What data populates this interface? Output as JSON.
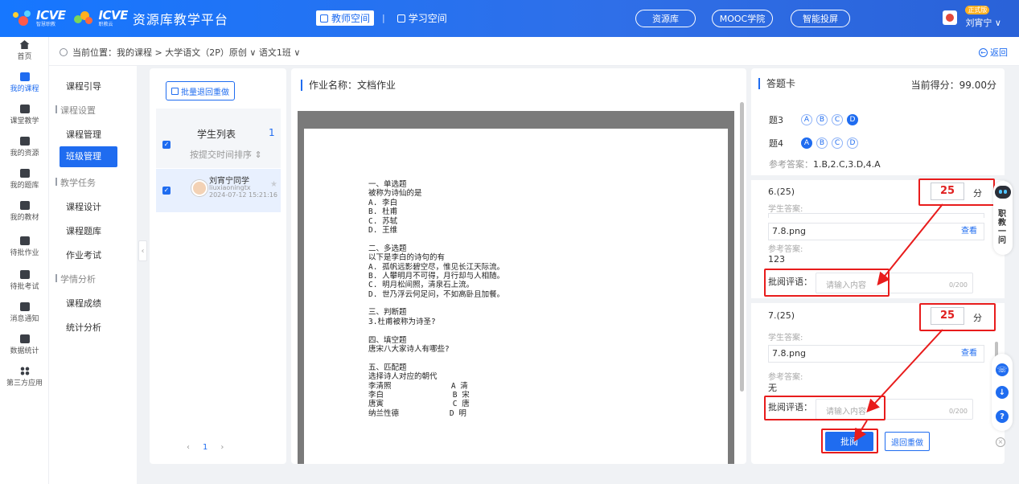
{
  "header": {
    "logo1_text": "ICVE",
    "logo1_sub": "智慧职教",
    "logo2_text": "ICVE",
    "logo2_sub": "职教云",
    "platform_title": "资源库教学平台",
    "tab_teacher": "教师空间",
    "tab_student": "学习空间",
    "nav_resources": "资源库",
    "nav_mooc": "MOOC学院",
    "nav_screen": "智能投屏",
    "user_badge": "正式版",
    "user_name": "刘宵宁 ∨"
  },
  "rail": [
    {
      "label": "首页",
      "icon": "home-icon"
    },
    {
      "label": "我的课程",
      "icon": "book-icon"
    },
    {
      "label": "课堂教学",
      "icon": "play-icon"
    },
    {
      "label": "我的资源",
      "icon": "folder-icon"
    },
    {
      "label": "我的题库",
      "icon": "question-bank-icon"
    },
    {
      "label": "我的教材",
      "icon": "textbook-icon"
    },
    {
      "label": "待批作业",
      "icon": "homework-icon"
    },
    {
      "label": "待批考试",
      "icon": "exam-icon"
    },
    {
      "label": "消息通知",
      "icon": "message-icon"
    },
    {
      "label": "数据统计",
      "icon": "stats-icon"
    },
    {
      "label": "第三方应用",
      "icon": "apps-icon"
    }
  ],
  "breadcrumb": {
    "text": "当前位置：我的课程 > 大学语文（2P）原创 ∨  语文1班 ∨",
    "back": "返回"
  },
  "subnav": {
    "guide": "课程引导",
    "group_settings": "课程设置",
    "course_manage": "课程管理",
    "class_manage": "班级管理",
    "group_tasks": "教学任务",
    "course_design": "课程设计",
    "course_bank": "课程题库",
    "homework_exam": "作业考试",
    "group_analysis": "学情分析",
    "course_grades": "课程成绩",
    "stats": "统计分析"
  },
  "students": {
    "batch_button": "批量退回重做",
    "title": "学生列表",
    "count": "1",
    "sort": "按提交时间排序 ⇕",
    "rows": [
      {
        "name": "刘宵宁同学",
        "id": "liuxiaoningtx",
        "time": "2024-07-12 15:21:16"
      }
    ],
    "page": "1"
  },
  "doc": {
    "title_label": "作业名称：",
    "title": "文档作业",
    "lines": [
      "一、单选题",
      "被称为诗仙的是",
      "A. 李白",
      "B. 杜甫",
      "C. 苏轼",
      "D. 王维",
      "",
      "二、多选题",
      "以下是李白的诗句的有",
      "A. 孤帆远影碧空尽，惟见长江天际流。",
      "B. 人攀明月不可得，月行却与人相随。",
      "C. 明月松间照，清泉石上流。",
      "D. 世乃浮云何足问，不如高卧且加餐。",
      "",
      "三、判断题",
      "3.杜甫被称为诗圣?",
      "",
      "四、填空题",
      "唐宋八大家诗人有哪些?",
      "",
      "五、匹配题",
      "选择诗人对应的朝代",
      "李清照             A 清",
      "李白               B 宋",
      "唐寅               C 唐",
      "纳兰性德           D 明"
    ]
  },
  "card": {
    "title": "答题卡",
    "score_label": "当前得分：",
    "score": "99.00分",
    "q3": {
      "label": "题3",
      "options": [
        "A",
        "B",
        "C",
        "D"
      ],
      "selected": "D"
    },
    "q4": {
      "label": "题4",
      "options": [
        "A",
        "B",
        "C",
        "D"
      ],
      "selected": "A"
    },
    "ref_label": "参考答案：",
    "ref_value": "1.B,2.C,3.D,4.A",
    "q6": {
      "title": "6.(25)",
      "score": "25",
      "unit": "分",
      "student_label": "学生答案:",
      "file": "7.8.png",
      "view": "查看",
      "ref_label": "参考答案:",
      "ref": "123",
      "comment_label": "批阅评语：",
      "comment_placeholder": "请输入内容",
      "count": "0/200"
    },
    "q7": {
      "title": "7.(25)",
      "score": "25",
      "unit": "分",
      "student_label": "学生答案:",
      "file": "7.8.png",
      "view": "查看",
      "ref_label": "参考答案:",
      "ref": "无",
      "comment_label": "批阅评语：",
      "comment_placeholder": "请输入内容",
      "count": "0/200"
    },
    "grade_button": "批阅",
    "redo_button": "退回重做"
  },
  "helper": {
    "text": "职教一问"
  },
  "colors": {
    "primary": "#1f6cf0",
    "highlight": "#e81c1c",
    "score_red": "#e02020"
  }
}
